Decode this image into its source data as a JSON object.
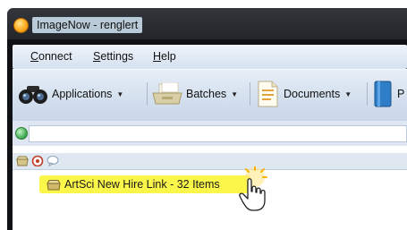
{
  "window": {
    "title": "ImageNow - renglert"
  },
  "menu": {
    "connect": {
      "accel": "C",
      "rest": "onnect"
    },
    "settings": {
      "accel": "S",
      "rest": "ettings"
    },
    "help": {
      "accel": "H",
      "rest": "elp"
    }
  },
  "toolbar": {
    "applications_label": "Applications",
    "batches_label": "Batches",
    "documents_label": "Documents",
    "partial_label": "P"
  },
  "list": {
    "items": [
      {
        "label": "ArtSci New Hire Link - 32 Items",
        "highlight_color": "#fbf64a"
      }
    ]
  },
  "colors": {
    "titlebar": "#22252a",
    "menubar": "#dde7f3",
    "toolbar": "#d4e0ee",
    "highlight": "#fbf64a"
  },
  "icons": [
    "app-orb-icon",
    "binoculars-icon",
    "batch-tray-icon",
    "document-icon",
    "book-icon",
    "globe-icon",
    "drawer-icon",
    "camera-icon",
    "speech-bubble-icon",
    "hand-cursor-icon"
  ]
}
